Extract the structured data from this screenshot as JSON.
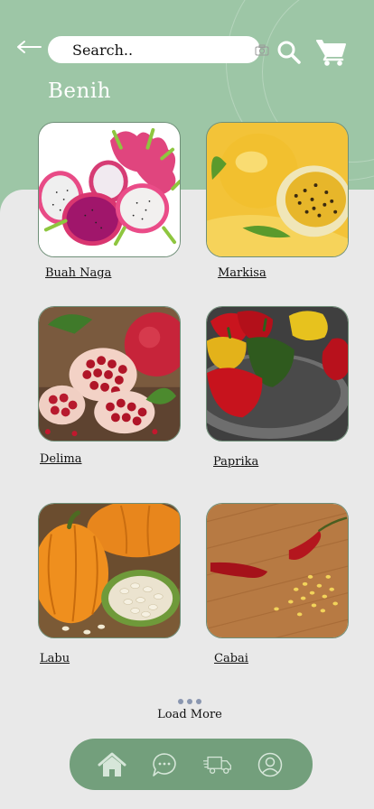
{
  "header": {
    "search_placeholder": "Search..",
    "title": "Benih"
  },
  "products": [
    {
      "label": "Buah Naga",
      "image": "dragon-fruit"
    },
    {
      "label": "Markisa",
      "image": "passion-fruit"
    },
    {
      "label": "Delima",
      "image": "pomegranate"
    },
    {
      "label": "Paprika",
      "image": "bell-peppers"
    },
    {
      "label": "Labu",
      "image": "pumpkin"
    },
    {
      "label": "Cabai",
      "image": "chili"
    }
  ],
  "load_more": {
    "label": "Load More"
  },
  "nav": {
    "items": [
      "home-icon",
      "chat-icon",
      "delivery-truck-icon",
      "profile-icon"
    ],
    "active": "home-icon"
  },
  "colors": {
    "header": "#9dc6a6",
    "background": "#e9e9e9",
    "nav": "#739f7c",
    "title": "#ffffff"
  }
}
